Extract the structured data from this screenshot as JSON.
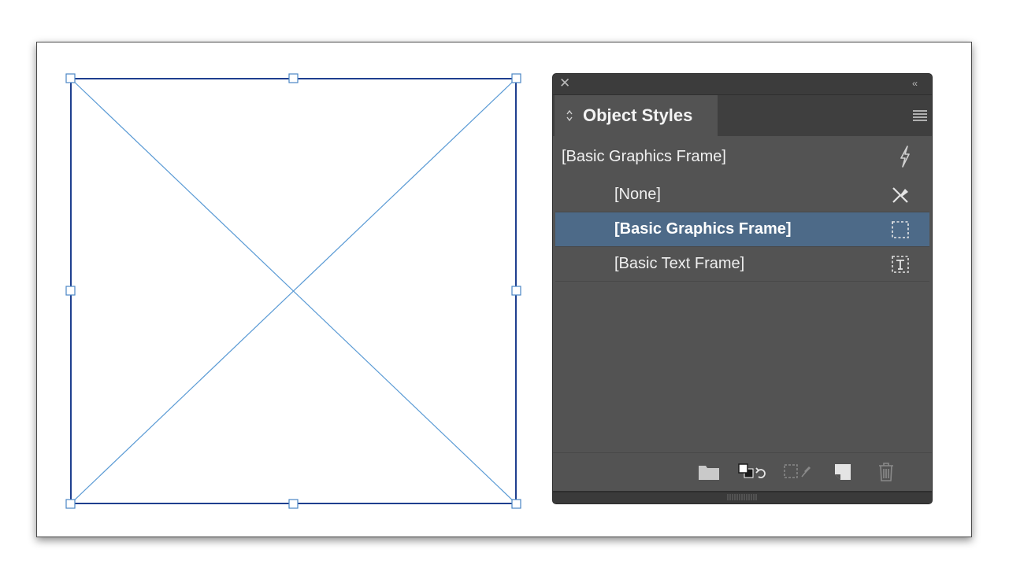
{
  "canvas": {
    "frame_stroke_color": "#1f3f8f",
    "diagonal_color": "#5b9bd5",
    "handle_color": "#4a86c5"
  },
  "panel": {
    "close_glyph": "✕",
    "collapse_glyph": "‹‹",
    "tab_label": "Object Styles",
    "default_style_label": "[Basic Graphics Frame]",
    "styles": [
      {
        "label": "[None]",
        "icon": "no-style-icon",
        "selected": false
      },
      {
        "label": "[Basic Graphics Frame]",
        "icon": "graphics-frame-icon",
        "selected": true
      },
      {
        "label": "[Basic Text Frame]",
        "icon": "text-frame-icon",
        "selected": false
      }
    ],
    "bottom_icons": [
      "new-group-folder-icon",
      "clear-overrides-icon",
      "clear-non-defined-attributes-icon",
      "new-style-icon",
      "delete-icon"
    ],
    "colors": {
      "panel_bg": "#535353",
      "selected_bg": "#4d6a88",
      "text": "#efefef"
    }
  }
}
